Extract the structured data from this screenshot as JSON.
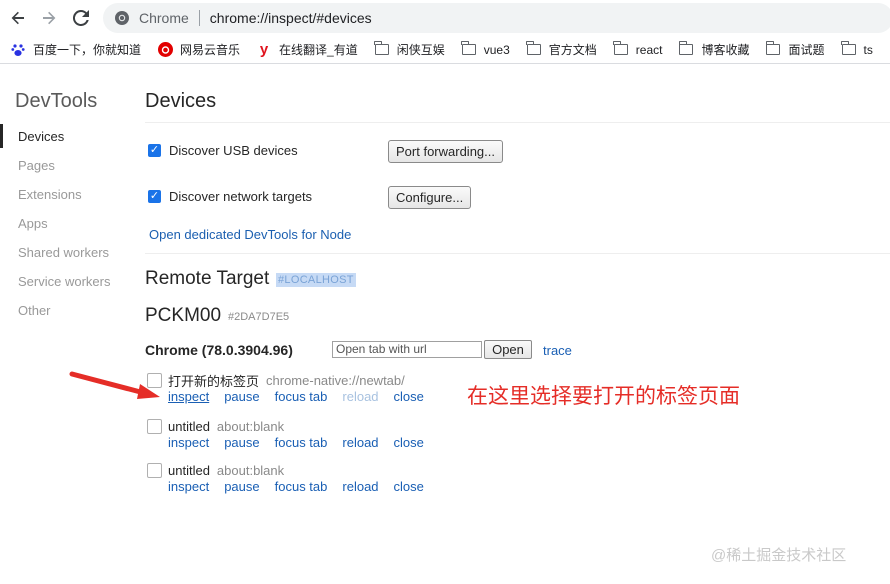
{
  "browser": {
    "tab_site_name": "Chrome",
    "url": "chrome://inspect/#devices",
    "bookmarks": [
      {
        "label": "百度一下，你就知道",
        "icon": "baidu-paw-icon"
      },
      {
        "label": "网易云音乐",
        "icon": "netease-music-icon"
      },
      {
        "label": "在线翻译_有道",
        "icon": "youdao-icon"
      },
      {
        "label": "闲侠互娱",
        "icon": "folder-icon"
      },
      {
        "label": "vue3",
        "icon": "folder-icon"
      },
      {
        "label": "官方文档",
        "icon": "folder-icon"
      },
      {
        "label": "react",
        "icon": "folder-icon"
      },
      {
        "label": "博客收藏",
        "icon": "folder-icon"
      },
      {
        "label": "面试题",
        "icon": "folder-icon"
      },
      {
        "label": "ts",
        "icon": "folder-icon"
      }
    ]
  },
  "sidebar": {
    "title": "DevTools",
    "items": [
      {
        "label": "Devices",
        "active": true
      },
      {
        "label": "Pages",
        "active": false
      },
      {
        "label": "Extensions",
        "active": false
      },
      {
        "label": "Apps",
        "active": false
      },
      {
        "label": "Shared workers",
        "active": false
      },
      {
        "label": "Service workers",
        "active": false
      },
      {
        "label": "Other",
        "active": false
      }
    ]
  },
  "main": {
    "title": "Devices",
    "discover_usb_label": "Discover USB devices",
    "port_forwarding_button": "Port forwarding...",
    "discover_network_label": "Discover network targets",
    "configure_button": "Configure...",
    "node_link": "Open dedicated DevTools for Node",
    "remote_target_title": "Remote Target",
    "localhost_tag": "#LOCALHOST",
    "device_name": "PCKM00",
    "device_id": "#2DA7D7E5",
    "browser_label": "Chrome (78.0.3904.96)",
    "url_input_placeholder": "Open tab with url",
    "open_button": "Open",
    "trace_link": "trace",
    "targets": [
      {
        "name": "打开新的标签页",
        "url": "chrome-native://newtab/"
      },
      {
        "name": "untitled",
        "url": "about:blank"
      },
      {
        "name": "untitled",
        "url": "about:blank"
      }
    ],
    "actions": {
      "inspect": "inspect",
      "pause": "pause",
      "focus_tab": "focus tab",
      "reload": "reload",
      "close": "close"
    }
  },
  "annotation": "在这里选择要打开的标签页面",
  "watermark": "@稀土掘金技术社区",
  "colors": {
    "link": "#1a5fb4",
    "annotation_red": "#e52d27",
    "checkbox_blue": "#1a73e8"
  }
}
